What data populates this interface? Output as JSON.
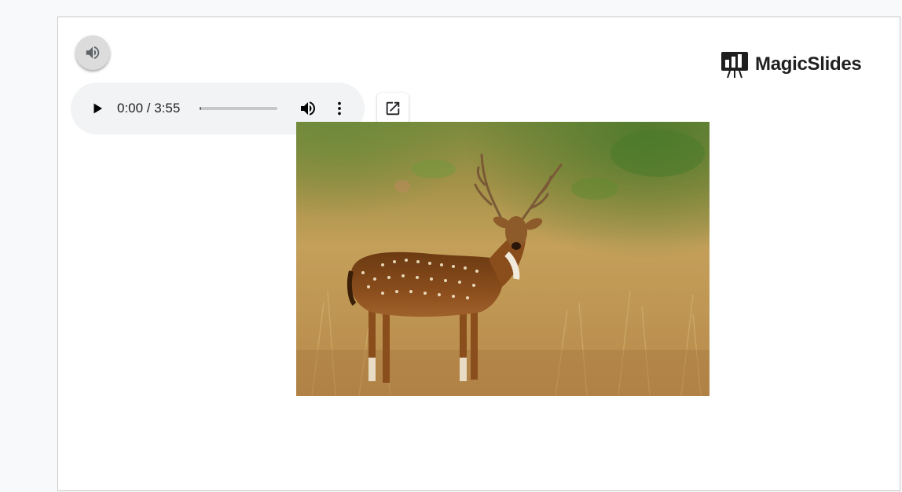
{
  "audio": {
    "time_display": "0:00 / 3:55",
    "progress": 0.01
  },
  "logo": {
    "text": "MagicSlides"
  },
  "colors": {
    "page_background": "#f8f9fa",
    "slide_background": "#ffffff",
    "player_background": "#f1f3f4",
    "icon": "#202124"
  },
  "icons": {
    "speaker": "volume-up-icon",
    "play": "play-icon",
    "volume": "volume-icon",
    "more": "more-vert-icon",
    "open": "open-in-new-icon",
    "logo": "presentation-board-icon"
  }
}
